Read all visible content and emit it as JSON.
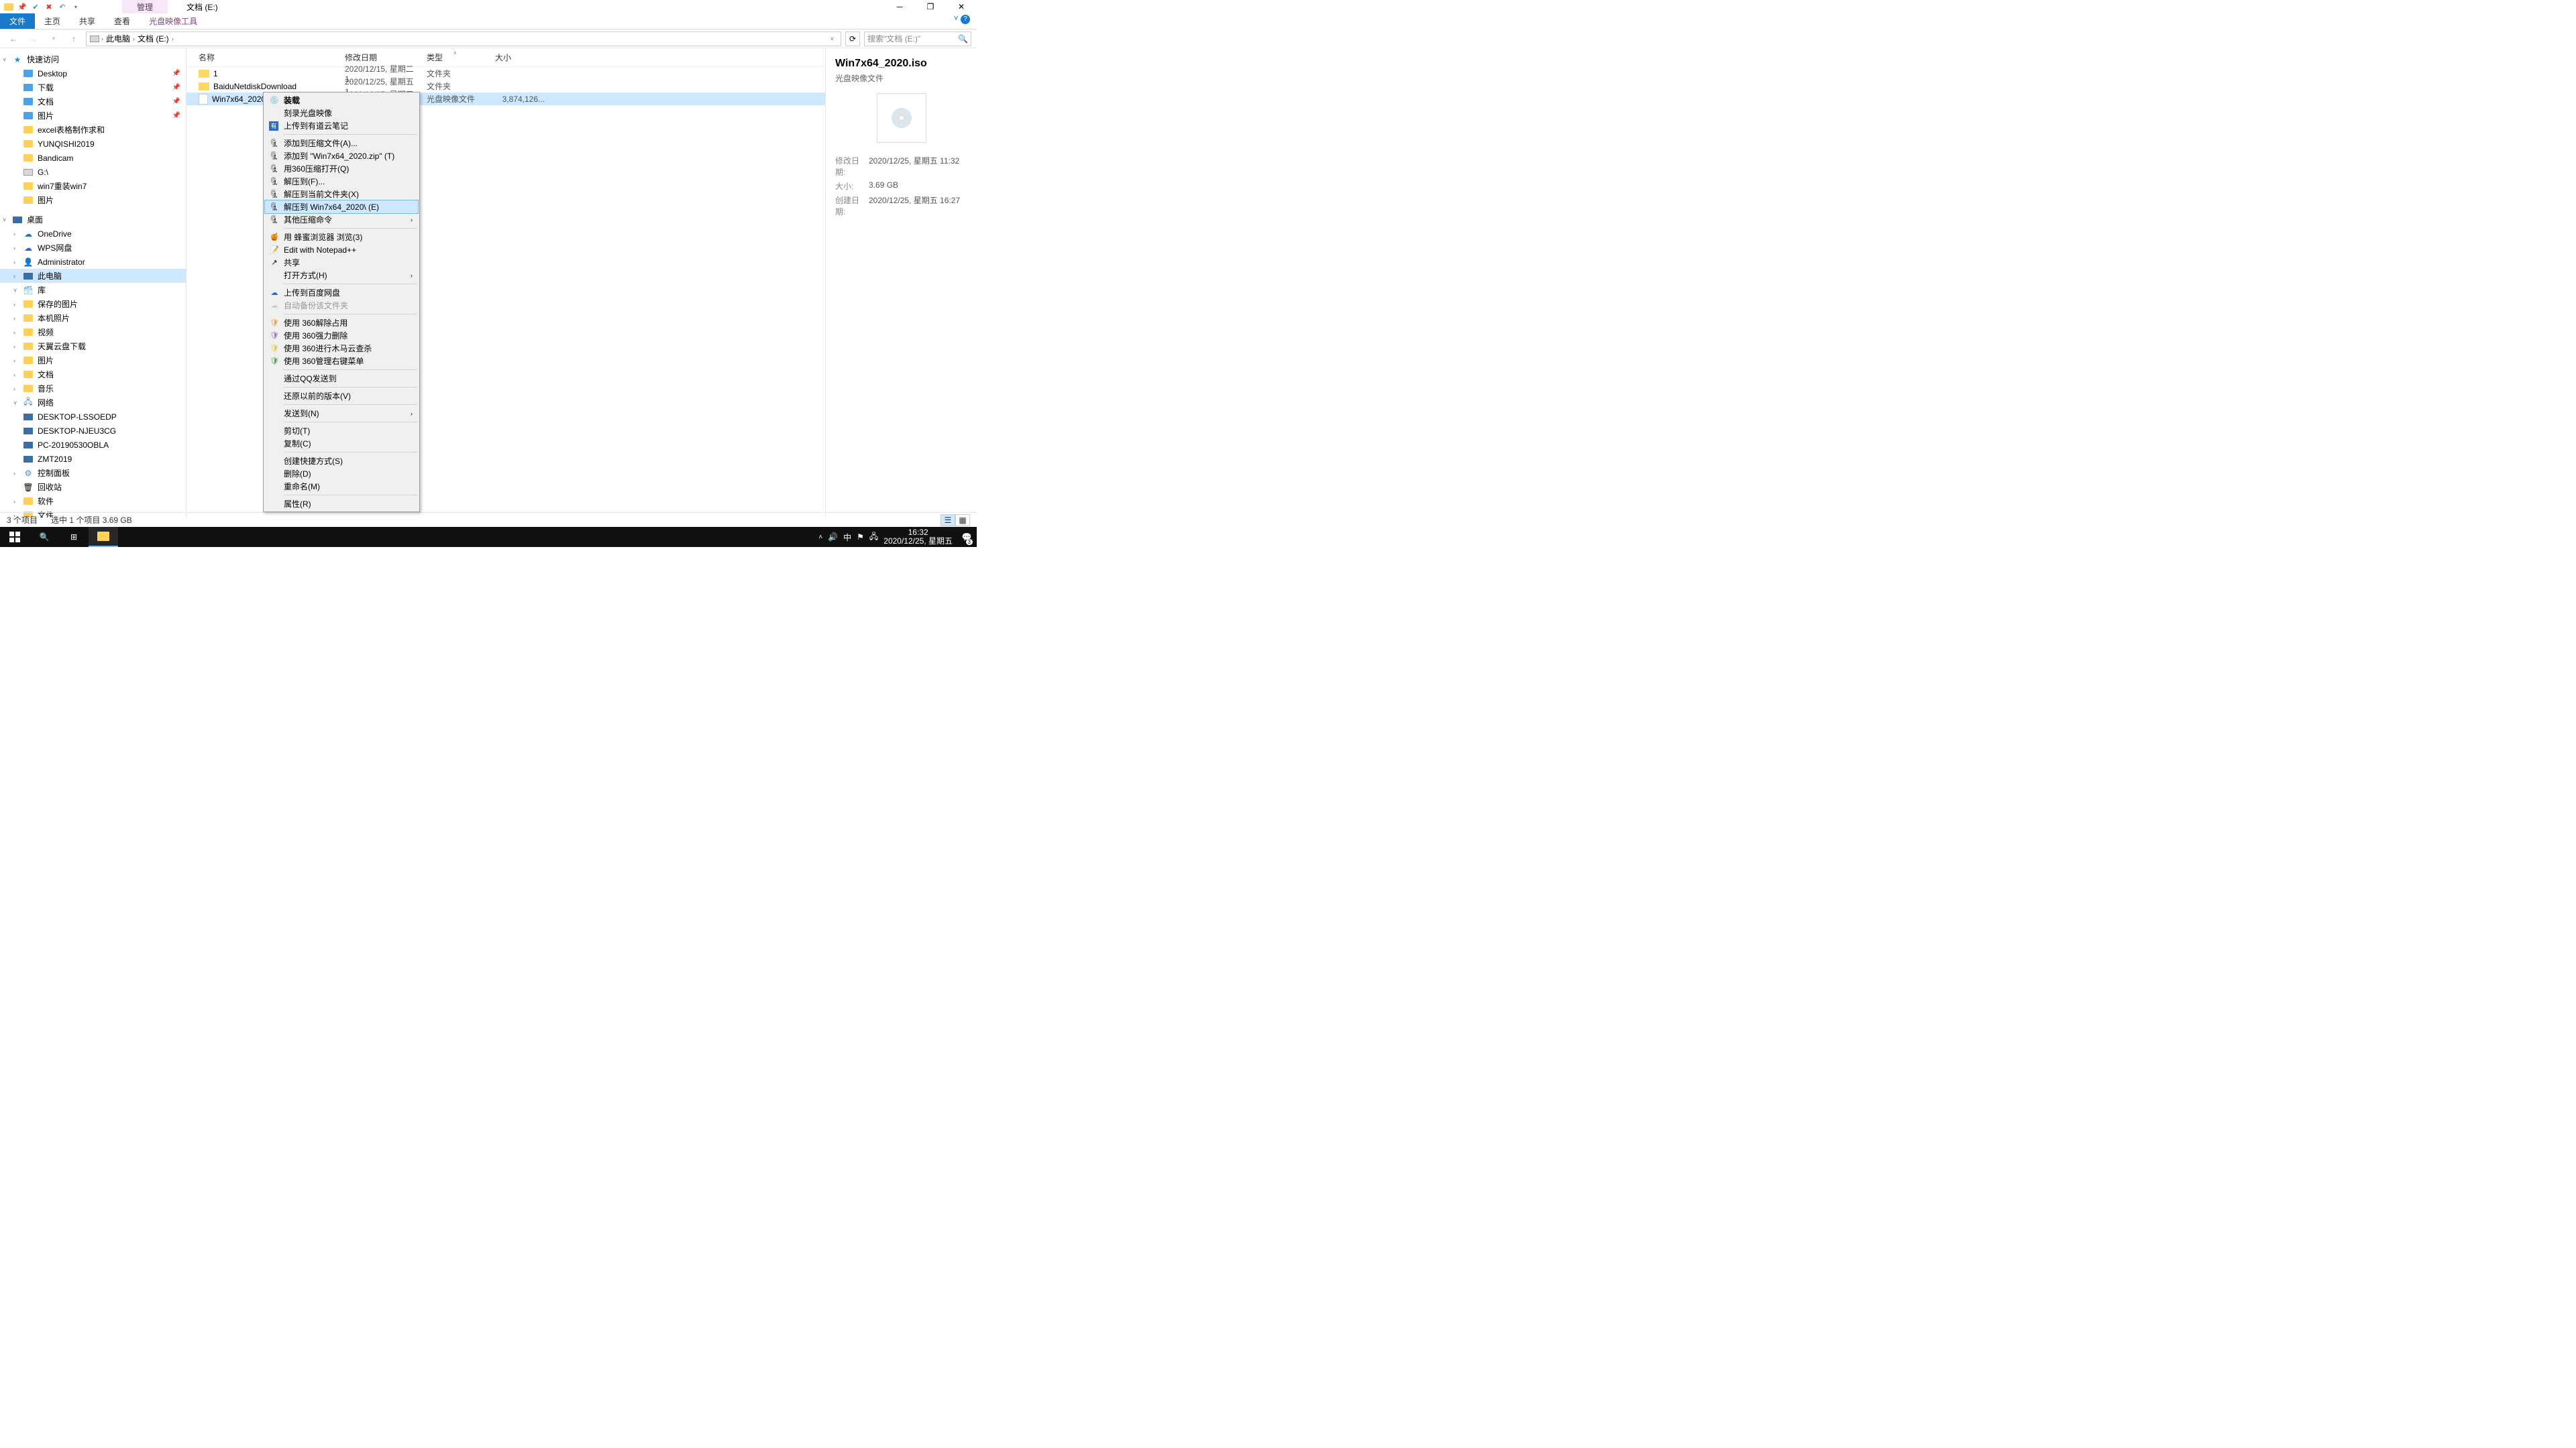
{
  "window": {
    "context_tab": "管理",
    "title": "文档 (E:)"
  },
  "ribbon": {
    "file": "文件",
    "home": "主页",
    "share": "共享",
    "view": "查看",
    "tools": "光盘映像工具"
  },
  "breadcrumb": {
    "root": "此电脑",
    "loc": "文档 (E:)",
    "search_placeholder": "搜索\"文档 (E:)\""
  },
  "tree": {
    "quick_access": "快速访问",
    "desktop": "Desktop",
    "downloads": "下载",
    "documents": "文档",
    "pictures": "图片",
    "excel": "excel表格制作求和",
    "yunqishi": "YUNQISHI2019",
    "bandicam": "Bandicam",
    "g_drive": "G:\\",
    "win7reinstall": "win7重装win7",
    "pictures2": "图片",
    "desktop2": "桌面",
    "onedrive": "OneDrive",
    "wps": "WPS网盘",
    "admin": "Administrator",
    "this_pc": "此电脑",
    "library": "库",
    "saved_pics": "保存的图片",
    "local_photos": "本机照片",
    "video": "视频",
    "tianyi": "天翼云盘下载",
    "pictures3": "图片",
    "documents2": "文档",
    "music": "音乐",
    "network": "网络",
    "d1": "DESKTOP-LSSOEDP",
    "d2": "DESKTOP-NJEU3CG",
    "d3": "PC-20190530OBLA",
    "d4": "ZMT2019",
    "ctrl_panel": "控制面板",
    "recycle": "回收站",
    "software": "软件",
    "files": "文件"
  },
  "columns": {
    "name": "名称",
    "date": "修改日期",
    "type": "类型",
    "size": "大小"
  },
  "rows": [
    {
      "name": "1",
      "date": "2020/12/15, 星期二 1...",
      "type": "文件夹",
      "size": ""
    },
    {
      "name": "BaiduNetdiskDownload",
      "date": "2020/12/25, 星期五 1...",
      "type": "文件夹",
      "size": ""
    },
    {
      "name": "Win7x64_2020.iso",
      "date": "2020/12/25, 星期五 1...",
      "type": "光盘映像文件",
      "size": "3,874,126..."
    }
  ],
  "details": {
    "title": "Win7x64_2020.iso",
    "subtitle": "光盘映像文件",
    "mod_label": "修改日期:",
    "mod_val": "2020/12/25, 星期五 11:32",
    "size_label": "大小:",
    "size_val": "3.69 GB",
    "create_label": "创建日期:",
    "create_val": "2020/12/25, 星期五 16:27"
  },
  "ctx": {
    "mount": "装载",
    "burn": "刻录光盘映像",
    "youdao": "上传到有道云笔记",
    "add_archive": "添加到压缩文件(A)...",
    "add_zip": "添加到 \"Win7x64_2020.zip\" (T)",
    "open_360zip": "用360压缩打开(Q)",
    "extract_to": "解压到(F)...",
    "extract_here": "解压到当前文件夹(X)",
    "extract_named": "解压到 Win7x64_2020\\ (E)",
    "other_zip": "其他压缩命令",
    "honey": "用 蜂蜜浏览器 浏览(3)",
    "notepadpp": "Edit with Notepad++",
    "share": "共享",
    "open_with": "打开方式(H)",
    "baidu": "上传到百度网盘",
    "auto_backup": "自动备份该文件夹",
    "unlock360": "使用 360解除占用",
    "force_del360": "使用 360强力删除",
    "trojan360": "使用 360进行木马云查杀",
    "menu360": "使用 360管理右键菜单",
    "qq_send": "通过QQ发送到",
    "restore": "还原以前的版本(V)",
    "send_to": "发送到(N)",
    "cut": "剪切(T)",
    "copy": "复制(C)",
    "shortcut": "创建快捷方式(S)",
    "delete": "删除(D)",
    "rename": "重命名(M)",
    "properties": "属性(R)"
  },
  "status": {
    "count": "3 个项目",
    "selection": "选中 1 个项目  3.69 GB"
  },
  "taskbar": {
    "ime": "中",
    "time": "16:32",
    "date": "2020/12/25, 星期五",
    "notif_count": "3"
  }
}
